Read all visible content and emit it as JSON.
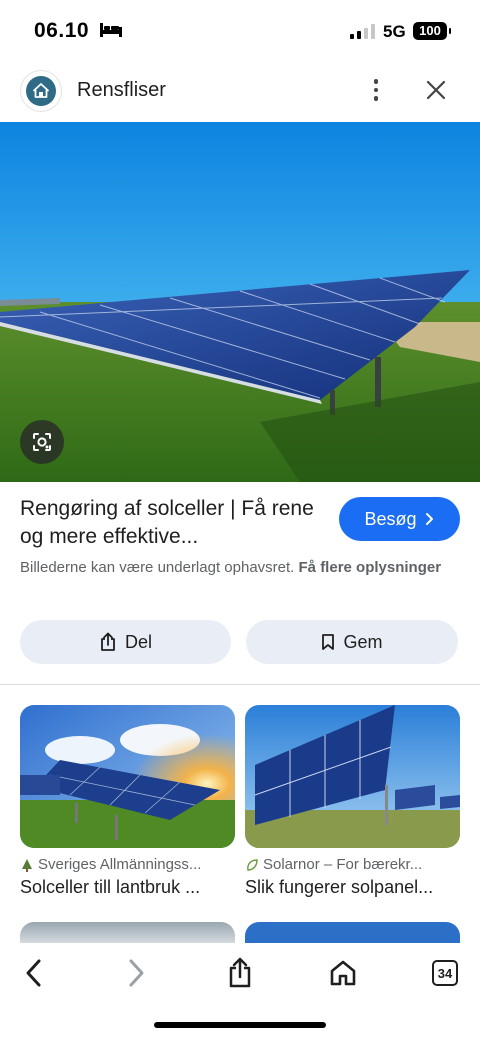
{
  "status_bar": {
    "time": "06.10",
    "network": "5G",
    "battery": "100",
    "icons": [
      "bed-icon",
      "signal-icon",
      "battery-icon"
    ]
  },
  "header": {
    "site_name": "Rensfliser",
    "icons": [
      "home-icon",
      "more-vert-icon",
      "close-icon"
    ]
  },
  "hero": {
    "icons": [
      "lens-icon"
    ]
  },
  "result": {
    "title": "Rengøring af solceller | Få rene og mere effektive...",
    "visit_label": "Besøg",
    "disclaimer_text": "Billederne kan være underlagt ophavsret.",
    "disclaimer_link": "Få flere oplysninger"
  },
  "actions": {
    "share_label": "Del",
    "save_label": "Gem"
  },
  "related": [
    {
      "source": "Sveriges Allmänningss...",
      "title": "Solceller till lantbruk ..."
    },
    {
      "source": "Solarnor – For bærekr...",
      "title": "Slik fungerer solpanel..."
    }
  ],
  "bottom_bar": {
    "tab_count": "34",
    "icons": [
      "back-icon",
      "forward-icon",
      "share-icon",
      "home-icon",
      "tabs-icon"
    ]
  },
  "colors": {
    "accent": "#1b6ef3",
    "pill_bg": "#e9eef6",
    "icon_circle": "#2f6b86"
  }
}
